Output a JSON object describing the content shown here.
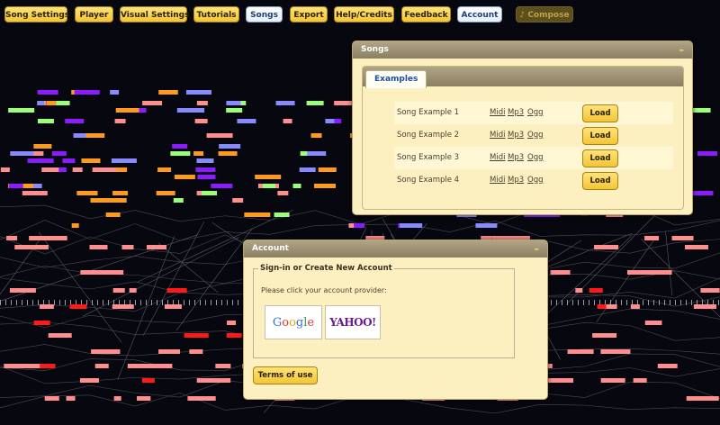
{
  "nav": {
    "items": [
      {
        "label": "Song Settings",
        "state": "normal"
      },
      {
        "label": "Player",
        "state": "normal"
      },
      {
        "label": "Visual Settings",
        "state": "normal"
      },
      {
        "label": "Tutorials",
        "state": "normal"
      },
      {
        "label": "Songs",
        "state": "active"
      },
      {
        "label": "Export",
        "state": "normal"
      },
      {
        "label": "Help/Credits",
        "state": "normal"
      },
      {
        "label": "Feedback",
        "state": "normal"
      },
      {
        "label": "Account",
        "state": "active"
      },
      {
        "label": "Compose",
        "state": "disabled",
        "icon": "music-note-icon"
      }
    ]
  },
  "songs_panel": {
    "title": "Songs",
    "collapse_symbol": "–",
    "tab_label": "Examples",
    "songs": [
      {
        "title": "Song Example 1",
        "midi": "Midi",
        "mp3": "Mp3",
        "ogg": "Ogg",
        "load": "Load"
      },
      {
        "title": "Song Example 2",
        "midi": "Midi",
        "mp3": "Mp3",
        "ogg": "Ogg",
        "load": "Load"
      },
      {
        "title": "Song Example 3",
        "midi": "Midi",
        "mp3": "Mp3",
        "ogg": "Ogg",
        "load": "Load"
      },
      {
        "title": "Song Example 4",
        "midi": "Midi",
        "mp3": "Mp3",
        "ogg": "Ogg",
        "load": "Load"
      }
    ]
  },
  "account_panel": {
    "title": "Account",
    "collapse_symbol": "–",
    "fieldset_legend": "Sign-in or Create New Account",
    "instructions": "Please click your account provider:",
    "providers": {
      "google": "Google",
      "yahoo": "YAHOO!"
    },
    "terms_label": "Terms of use"
  },
  "colors": {
    "button_fill": "#f3c536",
    "active_button_text": "#1c3f7a",
    "panel_background": "#fdf0c0",
    "note_colors": [
      "#ff8f8f",
      "#9cff7a",
      "#8a1cff",
      "#ff9a1a",
      "#8a8aff",
      "#ff1a1a"
    ]
  }
}
